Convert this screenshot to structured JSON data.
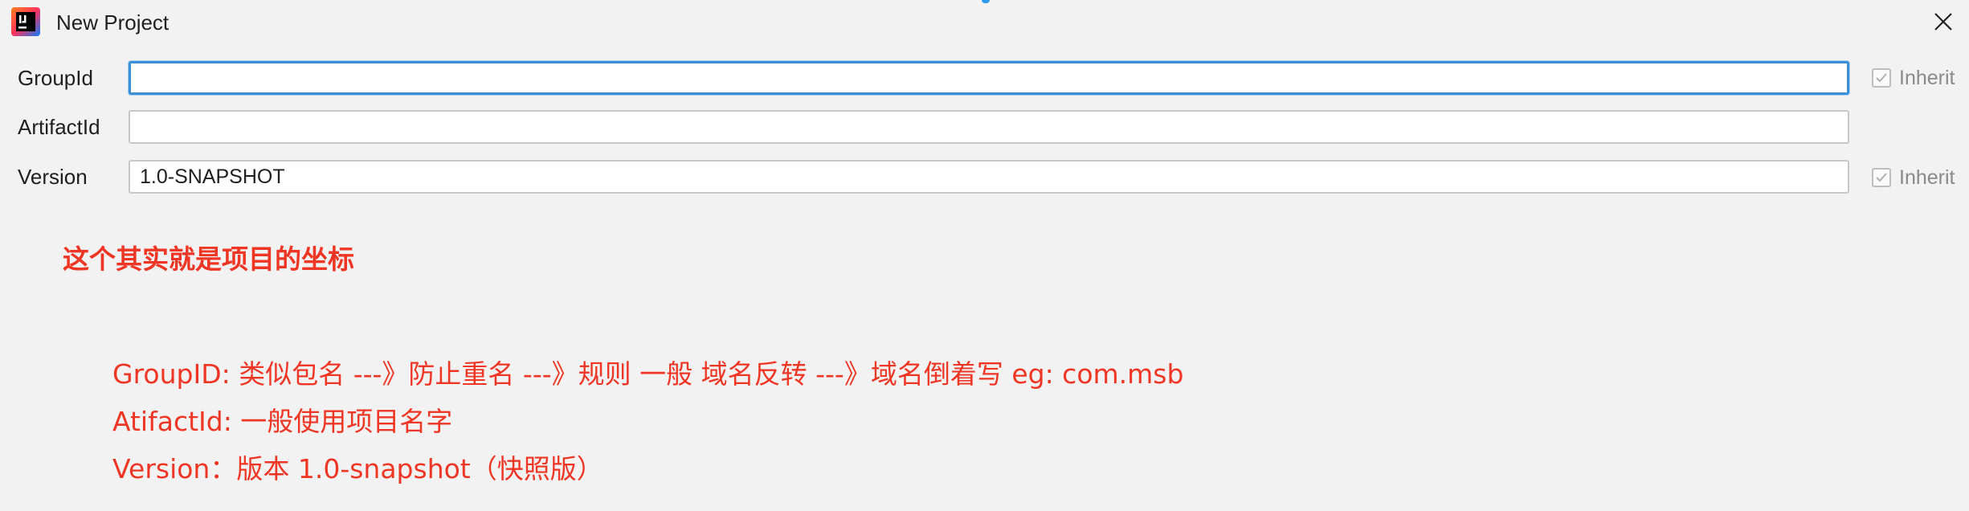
{
  "window": {
    "title": "New Project",
    "icon": "intellij-idea-icon",
    "close_icon": "close-icon"
  },
  "form": {
    "group_id": {
      "label": "GroupId",
      "value": "",
      "inherit_label": "Inherit",
      "inherit_checked": true
    },
    "artifact_id": {
      "label": "ArtifactId",
      "value": ""
    },
    "version": {
      "label": "Version",
      "value": "1.0-SNAPSHOT",
      "inherit_label": "Inherit",
      "inherit_checked": true
    }
  },
  "annotations": {
    "title": "这个其实就是项目的坐标",
    "notes": [
      "GroupID: 类似包名  ---》防止重名  ---》规则 一般  域名反转 ---》域名倒着写    eg:  com.msb",
      "AtifactId:  一般使用项目名字",
      "Version：版本   1.0-snapshot（快照版）"
    ]
  },
  "colors": {
    "annotation": "#ef3524",
    "focus_border": "#3a8fd8",
    "background": "#f2f2f2"
  }
}
